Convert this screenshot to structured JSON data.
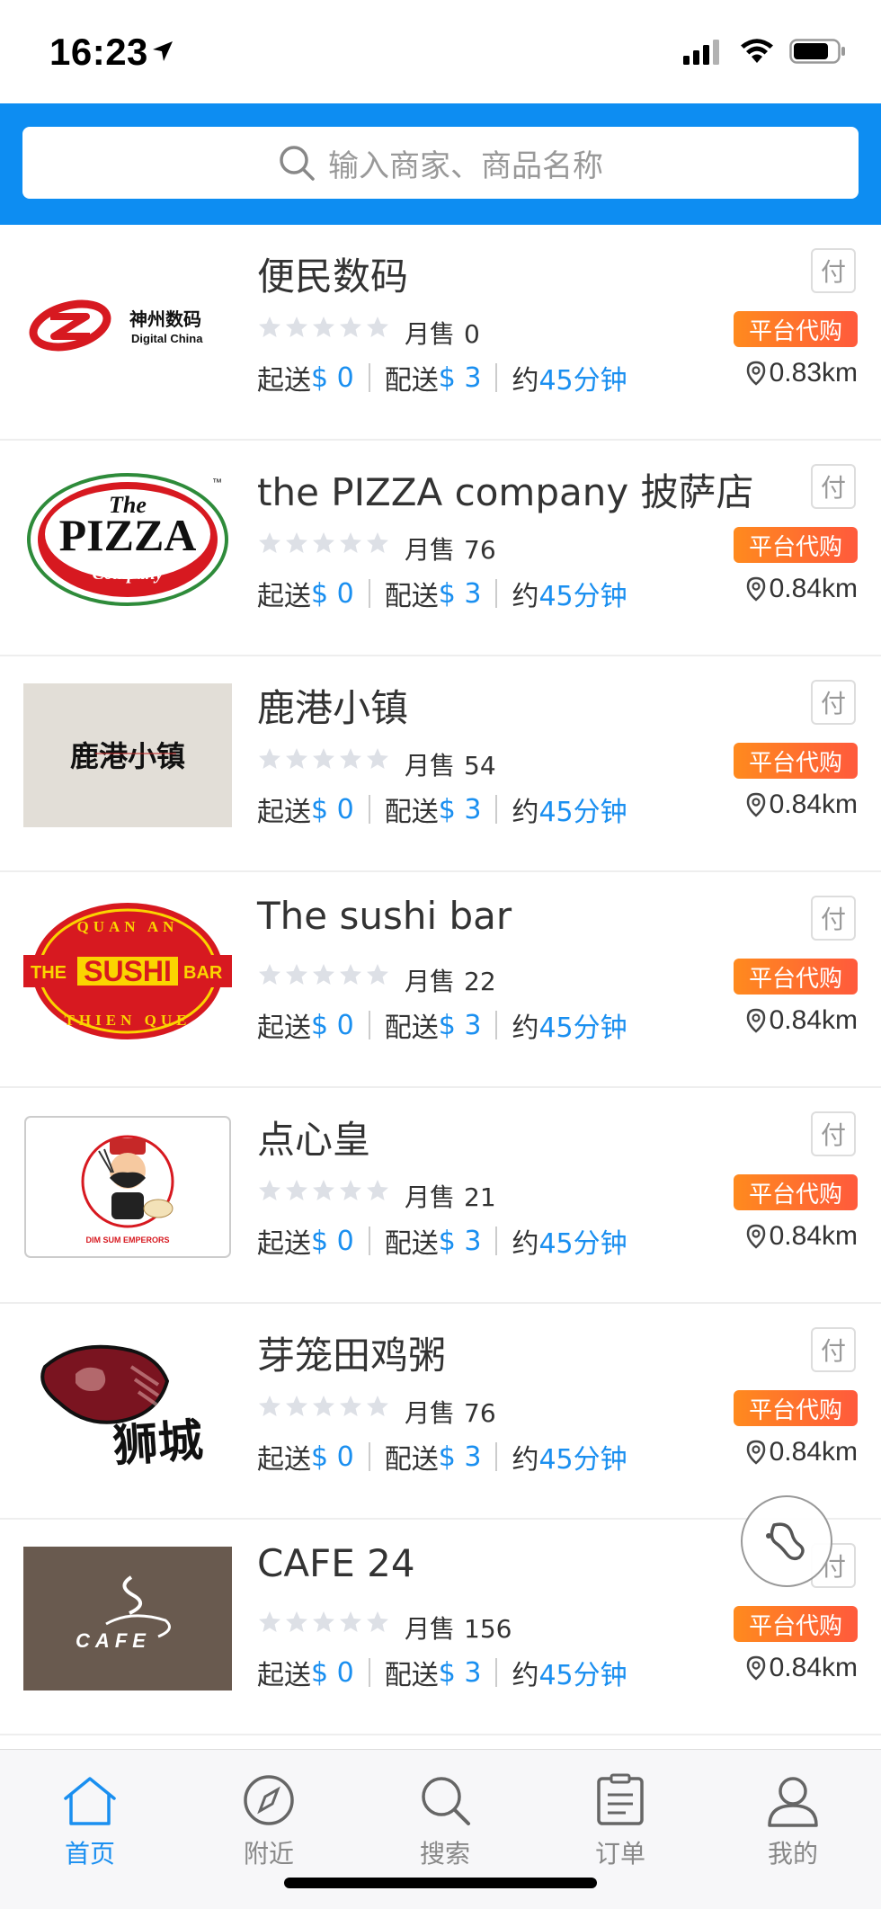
{
  "status_bar": {
    "time": "16:23"
  },
  "search": {
    "placeholder": "输入商家、商品名称"
  },
  "labels": {
    "monthly_sales": "月售",
    "min_order": "起送",
    "delivery_fee": "配送",
    "approx": "约",
    "pay_badge": "付",
    "agent_badge": "平台代购"
  },
  "stores": [
    {
      "name": "便民数码",
      "monthly_sales": "0",
      "min_order": "$ 0",
      "delivery_fee": "$ 3",
      "eta": "45分钟",
      "distance": "0.83km",
      "rating": 0,
      "logo": {
        "type": "digital-china",
        "text": "神州数码",
        "subtext": "Digital China"
      }
    },
    {
      "name": "the PIZZA company 披萨店",
      "monthly_sales": "76",
      "min_order": "$ 0",
      "delivery_fee": "$ 3",
      "eta": "45分钟",
      "distance": "0.84km",
      "rating": 0,
      "logo": {
        "type": "pizza",
        "text_top": "The",
        "text_main": "PIZZA",
        "text_bottom": "Company",
        "tm": "™"
      }
    },
    {
      "name": "鹿港小镇",
      "monthly_sales": "54",
      "min_order": "$ 0",
      "delivery_fee": "$ 3",
      "eta": "45分钟",
      "distance": "0.84km",
      "rating": 0,
      "logo": {
        "type": "lugang",
        "text": "鹿港小镇"
      }
    },
    {
      "name": "The sushi bar",
      "monthly_sales": "22",
      "min_order": "$ 0",
      "delivery_fee": "$ 3",
      "eta": "45分钟",
      "distance": "0.84km",
      "rating": 0,
      "logo": {
        "type": "sushi",
        "text_top": "QUAN AN",
        "text_left": "THE",
        "text_main": "SUSHI",
        "text_right": "BAR",
        "text_bottom": "THIEN QUE"
      }
    },
    {
      "name": "点心皇",
      "monthly_sales": "21",
      "min_order": "$ 0",
      "delivery_fee": "$ 3",
      "eta": "45分钟",
      "distance": "0.84km",
      "rating": 0,
      "logo": {
        "type": "dimsum",
        "text": "DIM SUM EMPERORS"
      }
    },
    {
      "name": "芽笼田鸡粥",
      "monthly_sales": "76",
      "min_order": "$ 0",
      "delivery_fee": "$ 3",
      "eta": "45分钟",
      "distance": "0.84km",
      "rating": 0,
      "logo": {
        "type": "lion",
        "text": "狮城"
      }
    },
    {
      "name": "CAFE 24",
      "monthly_sales": "156",
      "min_order": "$ 0",
      "delivery_fee": "$ 3",
      "eta": "45分钟",
      "distance": "0.84km",
      "rating": 0,
      "logo": {
        "type": "cafe",
        "text": "CAFE"
      }
    }
  ],
  "tabs": [
    {
      "label": "首页",
      "icon": "home-icon",
      "active": true
    },
    {
      "label": "附近",
      "icon": "compass-icon",
      "active": false
    },
    {
      "label": "搜索",
      "icon": "search-icon",
      "active": false
    },
    {
      "label": "订单",
      "icon": "order-list-icon",
      "active": false
    },
    {
      "label": "我的",
      "icon": "user-icon",
      "active": false
    }
  ],
  "colors": {
    "header_blue": "#0d8df2",
    "accent_blue": "#1a8ff0",
    "badge_orange": "#ff7a2a",
    "star_empty": "#dde0e6"
  },
  "float_button": {
    "icon": "footprint-icon"
  }
}
